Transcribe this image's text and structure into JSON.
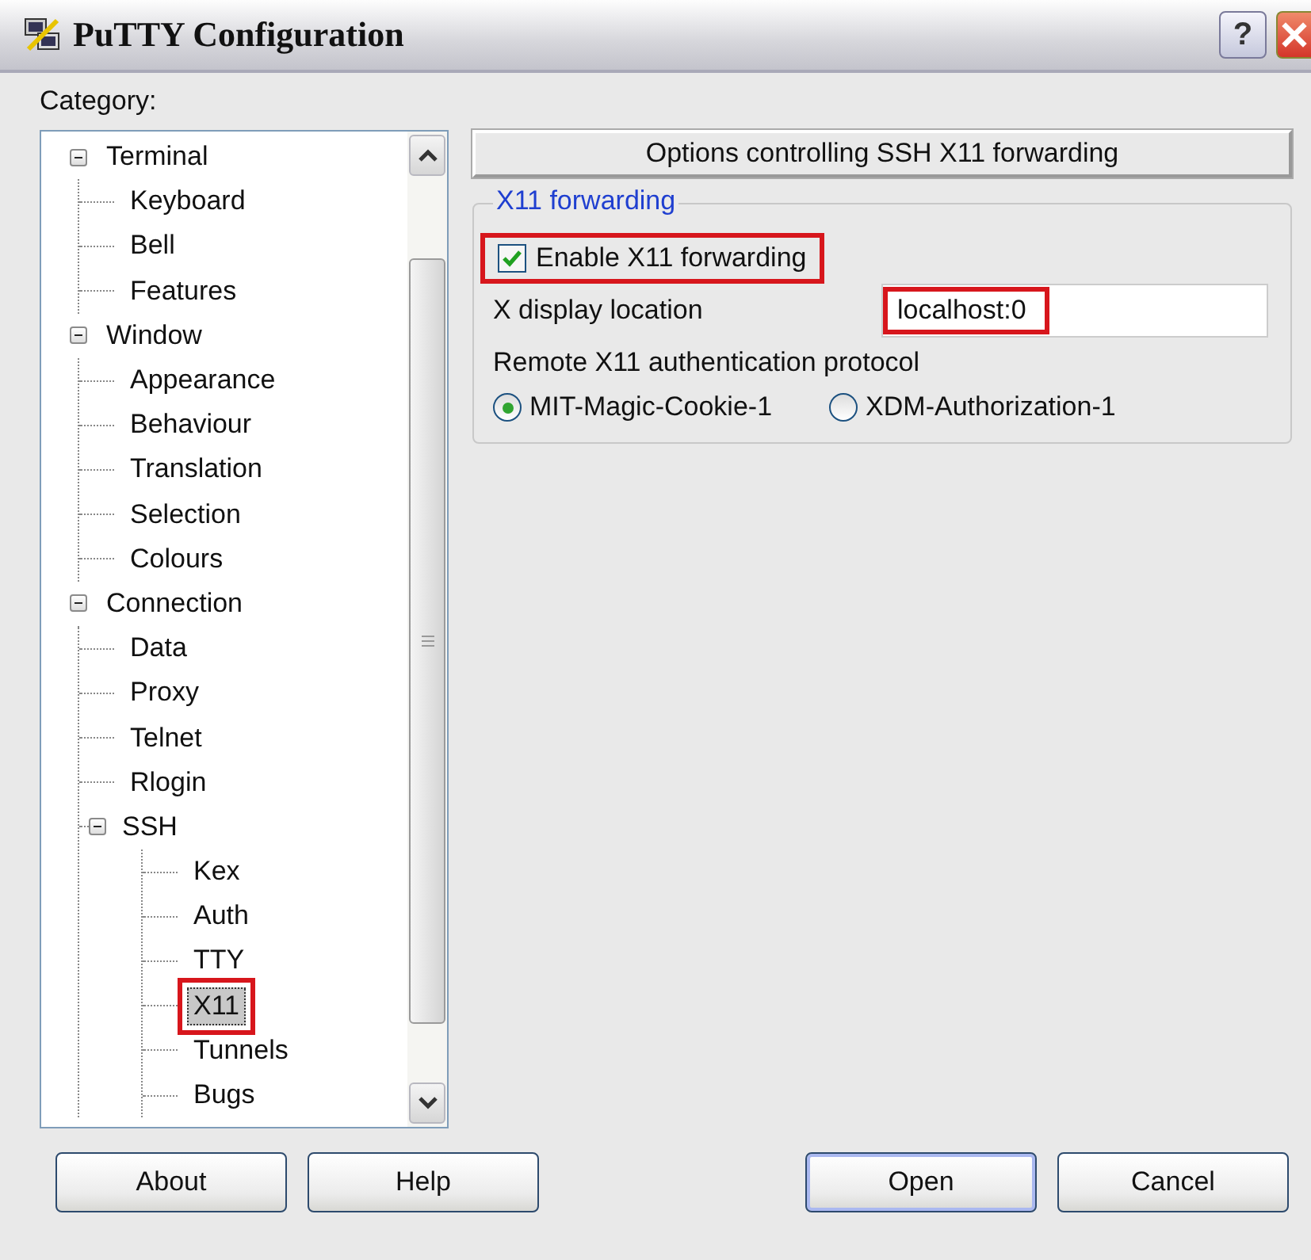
{
  "window": {
    "title": "PuTTY Configuration",
    "help_button": "?"
  },
  "category_label": "Category:",
  "tree": {
    "items": [
      {
        "label": "Terminal",
        "expanded": true,
        "selected": false,
        "highlighted": false,
        "children": [
          {
            "label": "Keyboard",
            "selected": false,
            "highlighted": false
          },
          {
            "label": "Bell",
            "selected": false,
            "highlighted": false
          },
          {
            "label": "Features",
            "selected": false,
            "highlighted": false
          }
        ]
      },
      {
        "label": "Window",
        "expanded": true,
        "selected": false,
        "highlighted": false,
        "children": [
          {
            "label": "Appearance",
            "selected": false,
            "highlighted": false
          },
          {
            "label": "Behaviour",
            "selected": false,
            "highlighted": false
          },
          {
            "label": "Translation",
            "selected": false,
            "highlighted": false
          },
          {
            "label": "Selection",
            "selected": false,
            "highlighted": false
          },
          {
            "label": "Colours",
            "selected": false,
            "highlighted": false
          }
        ]
      },
      {
        "label": "Connection",
        "expanded": true,
        "selected": false,
        "highlighted": false,
        "children": [
          {
            "label": "Data",
            "selected": false,
            "highlighted": false
          },
          {
            "label": "Proxy",
            "selected": false,
            "highlighted": false
          },
          {
            "label": "Telnet",
            "selected": false,
            "highlighted": false
          },
          {
            "label": "Rlogin",
            "selected": false,
            "highlighted": false
          },
          {
            "label": "SSH",
            "expanded": true,
            "selected": false,
            "highlighted": false,
            "children": [
              {
                "label": "Kex",
                "selected": false,
                "highlighted": false
              },
              {
                "label": "Auth",
                "selected": false,
                "highlighted": false
              },
              {
                "label": "TTY",
                "selected": false,
                "highlighted": false
              },
              {
                "label": "X11",
                "selected": true,
                "highlighted": true
              },
              {
                "label": "Tunnels",
                "selected": false,
                "highlighted": false
              },
              {
                "label": "Bugs",
                "selected": false,
                "highlighted": false
              }
            ]
          }
        ]
      }
    ]
  },
  "panel": {
    "header": "Options controlling SSH X11 forwarding",
    "group": {
      "title": "X11 forwarding",
      "enable": {
        "label": "Enable X11 forwarding",
        "checked": true,
        "highlighted": true
      },
      "display": {
        "label": "X display location",
        "value": "localhost:0",
        "highlighted": true
      },
      "auth_label": {
        "label": "Remote X11 authentication protocol"
      },
      "auth_options": [
        {
          "label": "MIT-Magic-Cookie-1",
          "selected": true
        },
        {
          "label": "XDM-Authorization-1",
          "selected": false
        }
      ]
    }
  },
  "buttons": [
    {
      "label": "About",
      "kind": "left",
      "default": false
    },
    {
      "label": "Help",
      "kind": "left",
      "default": false
    },
    {
      "label": "Open",
      "kind": "right",
      "default": true
    },
    {
      "label": "Cancel",
      "kind": "right",
      "default": false
    }
  ]
}
